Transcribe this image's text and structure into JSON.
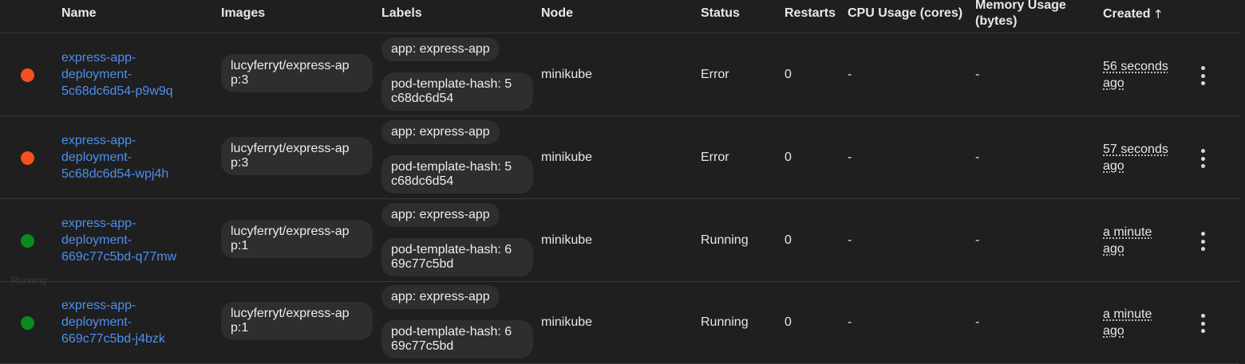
{
  "columns": {
    "name": "Name",
    "images": "Images",
    "labels": "Labels",
    "node": "Node",
    "status": "Status",
    "restarts": "Restarts",
    "cpu": "CPU Usage (cores)",
    "memory_line1": "Memory Usage",
    "memory_line2": "(bytes)",
    "created": "Created",
    "sort_arrow": "🡑"
  },
  "colors": {
    "error": "#f4511e",
    "running": "#0b8a1f",
    "link": "#4d8ff0"
  },
  "tooltip_ghost": "Running",
  "rows": [
    {
      "status_color": "error",
      "name_l1": "express-app-",
      "name_l2": "deployment-",
      "name_l3": "5c68dc6d54-p9w9q",
      "image_l1": "lucyferryt/express-ap",
      "image_l2": "p:3",
      "label1": "app: express-app",
      "label2_l1": "pod-template-hash: 5",
      "label2_l2": "c68dc6d54",
      "node": "minikube",
      "status": "Error",
      "restarts": "0",
      "cpu": "-",
      "memory": "-",
      "created_l1": "56 seconds",
      "created_l2": "ago"
    },
    {
      "status_color": "error",
      "name_l1": "express-app-",
      "name_l2": "deployment-",
      "name_l3": "5c68dc6d54-wpj4h",
      "image_l1": "lucyferryt/express-ap",
      "image_l2": "p:3",
      "label1": "app: express-app",
      "label2_l1": "pod-template-hash: 5",
      "label2_l2": "c68dc6d54",
      "node": "minikube",
      "status": "Error",
      "restarts": "0",
      "cpu": "-",
      "memory": "-",
      "created_l1": "57 seconds",
      "created_l2": "ago"
    },
    {
      "status_color": "running",
      "name_l1": "express-app-",
      "name_l2": "deployment-",
      "name_l3": "669c77c5bd-q77mw",
      "image_l1": "lucyferryt/express-ap",
      "image_l2": "p:1",
      "label1": "app: express-app",
      "label2_l1": "pod-template-hash: 6",
      "label2_l2": "69c77c5bd",
      "node": "minikube",
      "status": "Running",
      "restarts": "0",
      "cpu": "-",
      "memory": "-",
      "created_l1": "a minute",
      "created_l2": "ago"
    },
    {
      "status_color": "running",
      "name_l1": "express-app-",
      "name_l2": "deployment-",
      "name_l3": "669c77c5bd-j4bzk",
      "image_l1": "lucyferryt/express-ap",
      "image_l2": "p:1",
      "label1": "app: express-app",
      "label2_l1": "pod-template-hash: 6",
      "label2_l2": "69c77c5bd",
      "node": "minikube",
      "status": "Running",
      "restarts": "0",
      "cpu": "-",
      "memory": "-",
      "created_l1": "a minute",
      "created_l2": "ago"
    }
  ]
}
